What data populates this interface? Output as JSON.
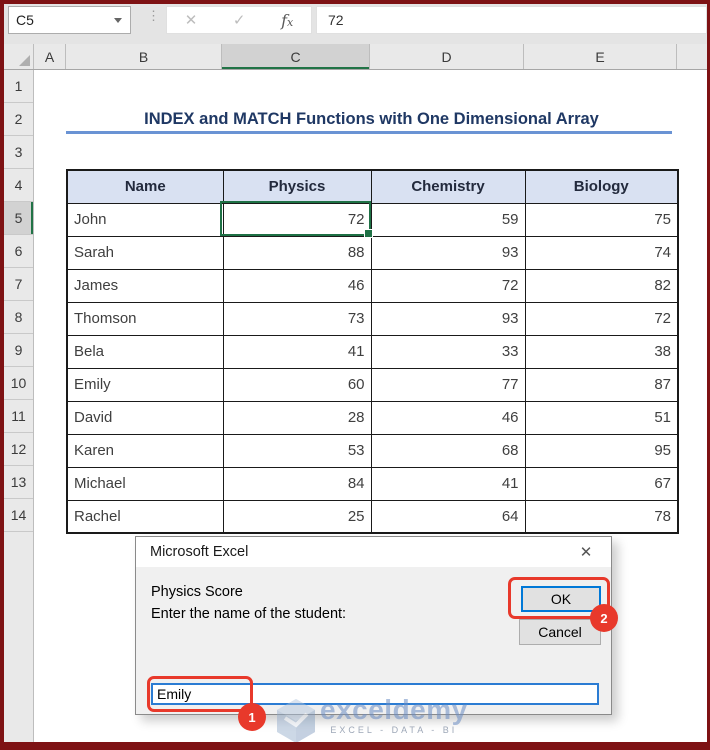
{
  "colors": {
    "frame_border": "#7E1214",
    "excel_green": "#1E7145",
    "table_header_fill": "#D9E1F2",
    "title_blue": "#1F3864",
    "underline_blue": "#6A93D4",
    "annotation_red": "#E8392B",
    "default_button_blue": "#0078D7"
  },
  "formula_bar": {
    "name_box_value": "C5",
    "cell_value": "72",
    "cancel_icon": "✕",
    "enter_icon": "✓",
    "fx_f": "f",
    "fx_x": "x",
    "dots": "⋮"
  },
  "sheet": {
    "column_headers": [
      "A",
      "B",
      "C",
      "D",
      "E"
    ],
    "selected_column": "C",
    "row_numbers": [
      "1",
      "2",
      "3",
      "4",
      "5",
      "6",
      "7",
      "8",
      "9",
      "10",
      "11",
      "12",
      "13",
      "14"
    ],
    "selected_row": "5",
    "title": "INDEX and MATCH Functions with One Dimensional Array"
  },
  "table": {
    "headers": [
      "Name",
      "Physics",
      "Chemistry",
      "Biology"
    ],
    "rows": [
      {
        "name": "John",
        "physics": "72",
        "chemistry": "59",
        "biology": "75"
      },
      {
        "name": "Sarah",
        "physics": "88",
        "chemistry": "93",
        "biology": "74"
      },
      {
        "name": "James",
        "physics": "46",
        "chemistry": "72",
        "biology": "82"
      },
      {
        "name": "Thomson",
        "physics": "73",
        "chemistry": "93",
        "biology": "72"
      },
      {
        "name": "Bela",
        "physics": "41",
        "chemistry": "33",
        "biology": "38"
      },
      {
        "name": "Emily",
        "physics": "60",
        "chemistry": "77",
        "biology": "87"
      },
      {
        "name": "David",
        "physics": "28",
        "chemistry": "46",
        "biology": "51"
      },
      {
        "name": "Karen",
        "physics": "53",
        "chemistry": "68",
        "biology": "95"
      },
      {
        "name": "Michael",
        "physics": "84",
        "chemistry": "41",
        "biology": "67"
      },
      {
        "name": "Rachel",
        "physics": "25",
        "chemistry": "64",
        "biology": "78"
      }
    ]
  },
  "dialog": {
    "title": "Microsoft Excel",
    "close_icon": "✕",
    "prompt_line1": "Physics Score",
    "prompt_line2": "Enter the name of the student:",
    "ok_label": "OK",
    "cancel_label": "Cancel",
    "input_value": "Emily",
    "step1_badge": "1",
    "step2_badge": "2"
  },
  "watermark": {
    "brand": "exceldemy",
    "tagline": "EXCEL - DATA - BI"
  }
}
